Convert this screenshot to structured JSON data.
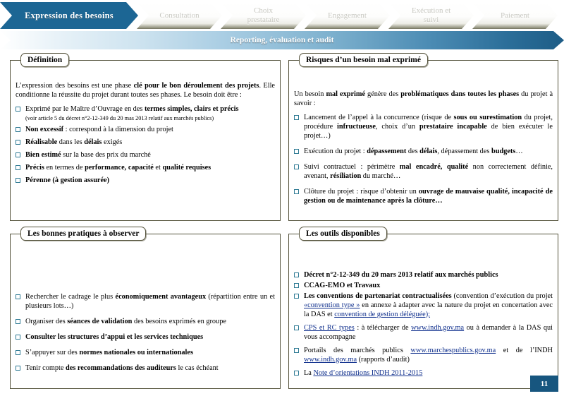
{
  "process": {
    "steps": [
      {
        "label": "Expression des besoins",
        "active": true
      },
      {
        "label": "Consultation",
        "active": false
      },
      {
        "label": "Choix\nprestataire",
        "active": false
      },
      {
        "label": "Engagement",
        "active": false
      },
      {
        "label": "Exécution et\nsuivi",
        "active": false
      },
      {
        "label": "Paiement",
        "active": false
      }
    ],
    "reporting_bar": "Reporting, évaluation et audit"
  },
  "panels": {
    "definition": {
      "title": "Définition",
      "intro_1": "L’expression des besoins est une phase ",
      "intro_1_b": "clé pour le bon déroulement des projets",
      "intro_2": ". Elle conditionne la réussite du projet durant toutes ses phases. Le besoin doit être :",
      "items": [
        {
          "pre": "Exprimé par le Maître d’Ouvrage en des ",
          "bold": "termes simples, clairs et précis",
          "post": "",
          "note": "(voir article 5 du décret n°2-12-349 du 20 mas 2013 relatif aux marchés publics)"
        },
        {
          "pre": "",
          "bold": "Non excessif",
          "post": " : correspond à la dimension du projet",
          "note": ""
        },
        {
          "pre": "",
          "bold": "Réalisable",
          "post": " dans les ",
          "bold2": "délais",
          "post2": " exigés",
          "note": ""
        },
        {
          "pre": "",
          "bold": "Bien estimé",
          "post": " sur la base des prix du marché",
          "note": ""
        },
        {
          "pre": "",
          "bold": "Précis",
          "post": " en termes de ",
          "bold2": "performance, capacité",
          "post2": " et ",
          "bold3": "qualité requises",
          "note": ""
        },
        {
          "pre": "",
          "bold": "Pérenne (à gestion assurée)",
          "post": "",
          "note": ""
        }
      ]
    },
    "risques": {
      "title": "Risques d’un besoin mal exprimé",
      "intro_a": "Un besoin ",
      "intro_b": "mal exprimé",
      "intro_c": " génère des ",
      "intro_d": "problématiques dans toutes les phases",
      "intro_e": " du projet à savoir :",
      "items": [
        {
          "p1": "Lancement de l’appel à la concurrence (risque de ",
          "b1": "sous ou surestimation",
          "p2": " du projet, procédure ",
          "b2": "infructueuse",
          "p3": ", choix d’un ",
          "b3": "prestataire incapable",
          "p4": " de bien exécuter le projet…)"
        },
        {
          "p1": "Exécution du projet : ",
          "b1": "dépassement",
          "p2": " des ",
          "b2": "délais",
          "p3": ", dépassement des ",
          "b3": "budgets",
          "p4": "…"
        },
        {
          "p1": "Suivi contractuel : périmètre ",
          "b1": "mal encadré, qualité",
          "p2": " non correctement définie, avenant, ",
          "b2": "résiliation",
          "p3": " du marché…",
          "b3": "",
          "p4": ""
        },
        {
          "p1": "Clôture du projet : risque d’obtenir un ",
          "b1": "ouvrage de mauvaise qualité, incapacité de gestion ou de maintenance après la clôture…",
          "p2": "",
          "b2": "",
          "p3": "",
          "b3": "",
          "p4": ""
        }
      ]
    },
    "pratiques": {
      "title": "Les bonnes pratiques à observer",
      "items": [
        {
          "pre": "Rechercher le cadrage le plus ",
          "bold": "économiquement avantageux",
          "post": " (répartition entre un et plusieurs lots…)"
        },
        {
          "pre": "Organiser des ",
          "bold": "séances de validation",
          "post": " des besoins exprimés en groupe"
        },
        {
          "pre": "",
          "bold": "Consulter les structures d’appui et les services techniques",
          "post": ""
        },
        {
          "pre": "S’appuyer sur des ",
          "bold": "normes nationales ou internationales",
          "post": ""
        },
        {
          "pre": "Tenir compte ",
          "bold": "des recommandations des auditeurs",
          "post": " le cas échéant"
        }
      ]
    },
    "outils": {
      "title": "Les outils disponibles",
      "items": [
        {
          "kind": "bold",
          "text": "Décret n°2-12-349 du 20 mars 2013 relatif aux marchés publics"
        },
        {
          "kind": "bold",
          "text": "CCAG-EMO et Travaux"
        },
        {
          "kind": "mixed_conventions",
          "bold": "Les conventions de partenariat contractualisées",
          "t1": " (convention d’exécution du projet ",
          "link1": "«convention type »",
          "t2": " en annexe à adapter avec la nature du projet en concertation avec la DAS et ",
          "link2": "convention de gestion déléguée);"
        },
        {
          "kind": "mixed_cps",
          "link1": "CPS et RC types",
          "t1": " : à télécharger de ",
          "link2": "www.indh.gov.ma",
          "t2": " ou à demander à la DAS qui vous accompagne"
        },
        {
          "kind": "mixed_portails",
          "t1": "Portails des marchés publics ",
          "link1": "www.marchespublics.gov.ma",
          "t2": " et de l’INDH ",
          "link2": "www.indh.gov.ma",
          "t3": " (rapports d’audit)"
        },
        {
          "kind": "mixed_note",
          "t1": "La ",
          "link1": "Note d’orientations INDH 2011-2015"
        }
      ]
    }
  },
  "page_number": "11",
  "colors": {
    "active_chevron": "#1C6694",
    "panel_border": "#55533C",
    "checkbox": "#2E7A94",
    "link": "#0E2E8C",
    "badge": "#17567F"
  }
}
